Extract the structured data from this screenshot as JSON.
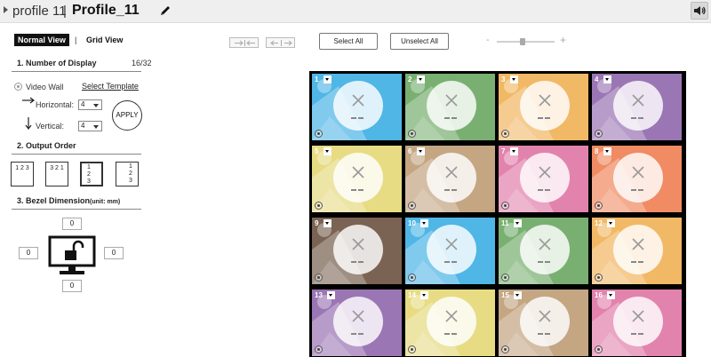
{
  "header": {
    "profile_label": "profile 11",
    "separator": "|",
    "profile_name": "Profile_11",
    "edit_icon": "pencil-icon",
    "speaker_icon": "speaker-icon"
  },
  "view_tabs": {
    "normal": "Normal View",
    "separator": "|",
    "grid": "Grid View",
    "active": "Normal View"
  },
  "number_of_display": {
    "title": "1.   Number of Display",
    "count": "16/32",
    "mode_label": "Video Wall",
    "select_template": "Select Template",
    "horizontal_label": "Horizontal:",
    "horizontal_value": "4",
    "vertical_label": "Vertical:",
    "vertical_value": "4",
    "apply": "APPLY"
  },
  "output_order": {
    "title": "2.   Output Order",
    "options": [
      {
        "label": "1 2 3"
      },
      {
        "label": "3 2 1"
      },
      {
        "label": "1 2 3"
      },
      {
        "label": "1 2 3"
      }
    ],
    "selected_index": 2
  },
  "bezel": {
    "title": "3.   Bezel Dimension",
    "unit": "(unit: mm)",
    "top": "0",
    "left": "0",
    "right": "0",
    "bottom": "0",
    "lock_icon": "unlock-icon"
  },
  "toolbar": {
    "select_all": "Select All",
    "unselect_all": "Unselect All",
    "zoom_minus": "-",
    "zoom_plus": "+",
    "zoom_level": 0.45
  },
  "colors": {
    "header_bg": "#efefef",
    "accent": "#111111"
  },
  "displays": [
    {
      "num": "1",
      "color": "#4fb6e6"
    },
    {
      "num": "2",
      "color": "#79b072"
    },
    {
      "num": "3",
      "color": "#f1b866"
    },
    {
      "num": "4",
      "color": "#9b76b4"
    },
    {
      "num": "5",
      "color": "#e7dc83"
    },
    {
      "num": "6",
      "color": "#c4a683"
    },
    {
      "num": "7",
      "color": "#e283ad"
    },
    {
      "num": "8",
      "color": "#f08b63"
    },
    {
      "num": "9",
      "color": "#7a6352"
    },
    {
      "num": "10",
      "color": "#4fb6e6"
    },
    {
      "num": "11",
      "color": "#79b072"
    },
    {
      "num": "12",
      "color": "#f1b866"
    },
    {
      "num": "13",
      "color": "#9b76b4"
    },
    {
      "num": "14",
      "color": "#e7dc83"
    },
    {
      "num": "15",
      "color": "#c4a683"
    },
    {
      "num": "16",
      "color": "#e283ad"
    }
  ]
}
